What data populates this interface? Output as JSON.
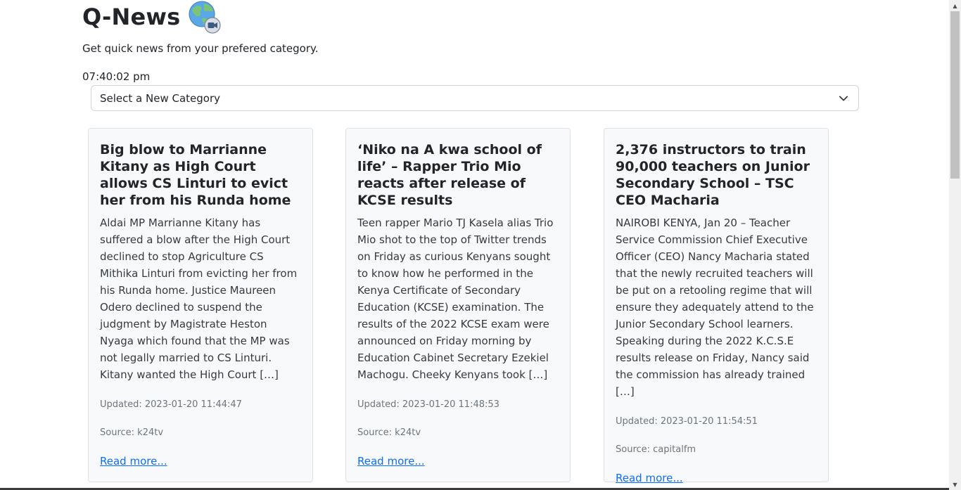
{
  "app": {
    "title": "Q-News",
    "logo_icon": "globe-camera-icon",
    "tagline": "Get quick news from your prefered category.",
    "clock": "07:40:02 pm"
  },
  "category_select": {
    "value": "Select a New Category",
    "icon": "chevron-down-icon"
  },
  "articles": [
    {
      "title": "Big blow to Marrianne Kitany as High Court allows CS Linturi to evict her from his Runda home",
      "summary": "Aldai MP Marrianne Kitany has suffered a blow after the High Court declined to stop Agriculture CS Mithika Linturi from evicting her from his Runda home. Justice Maureen Odero declined to suspend the judgment by Magistrate Heston Nyaga which found that the MP was not legally married to CS Linturi. Kitany wanted the High Court […]",
      "updated": "Updated: 2023-01-20 11:44:47",
      "source": "Source: k24tv",
      "link": "Read more..."
    },
    {
      "title": "‘Niko na A kwa school of life’ – Rapper Trio Mio reacts after release of KCSE results",
      "summary": "Teen rapper Mario TJ Kasela alias Trio Mio shot to the top of Twitter trends on Friday as curious Kenyans sought to know how he performed in the Kenya Certificate of Secondary Education (KCSE) examination. The results of the 2022 KCSE exam were announced on Friday morning by Education Cabinet Secretary Ezekiel Machogu. Cheeky Kenyans took […]",
      "updated": "Updated: 2023-01-20 11:48:53",
      "source": "Source: k24tv",
      "link": "Read more..."
    },
    {
      "title": "2,376 instructors to train 90,000 teachers on Junior Secondary School – TSC CEO Macharia",
      "summary": "NAIROBI KENYA, Jan 20 – Teacher Service Commission Chief Executive Officer (CEO) Nancy Macharia stated that the newly recruited teachers will be put on a retooling regime that will ensure they adequately attend to the Junior Secondary School learners. Speaking during the 2022 K.C.S.E results release on Friday, Nancy said the commission has already trained […]",
      "updated": "Updated: 2023-01-20 11:54:51",
      "source": "Source: capitalfm",
      "link": "Read more..."
    }
  ]
}
